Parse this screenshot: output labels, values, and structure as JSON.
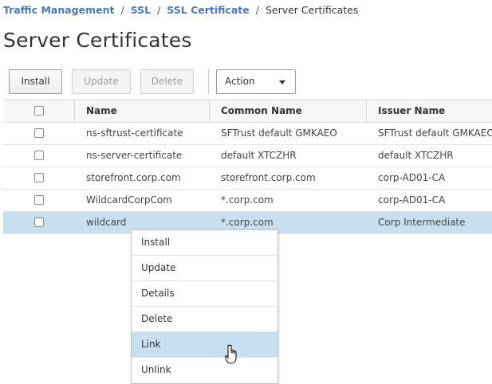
{
  "breadcrumb": {
    "items": [
      "Traffic Management",
      "SSL",
      "SSL Certificate"
    ],
    "separator": "/",
    "current": "Server Certificates"
  },
  "page_title": "Server Certificates",
  "toolbar": {
    "install_label": "Install",
    "update_label": "Update",
    "delete_label": "Delete",
    "action_label": "Action"
  },
  "table": {
    "columns": [
      "Name",
      "Common Name",
      "Issuer Name"
    ],
    "rows": [
      {
        "name": "ns-sftrust-certificate",
        "common_name": "SFTrust default GMKAEO",
        "issuer": "SFTrust default GMKAEO"
      },
      {
        "name": "ns-server-certificate",
        "common_name": "default XTCZHR",
        "issuer": "default XTCZHR"
      },
      {
        "name": "storefront.corp.com",
        "common_name": "storefront.corp.com",
        "issuer": "corp-AD01-CA"
      },
      {
        "name": "WildcardCorpCom",
        "common_name": "*.corp.com",
        "issuer": "corp-AD01-CA"
      },
      {
        "name": "wildcard",
        "common_name": "*.corp.com",
        "issuer": "Corp Intermediate"
      }
    ]
  },
  "context_menu": {
    "items": [
      "Install",
      "Update",
      "Details",
      "Delete",
      "Link",
      "Unlink"
    ]
  },
  "colors": {
    "link": "#4a7ab0",
    "selection": "#c7dfee"
  }
}
